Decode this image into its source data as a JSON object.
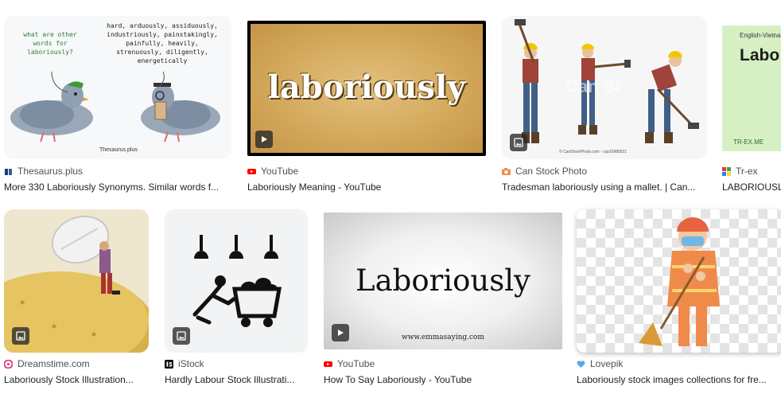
{
  "results": [
    {
      "source": "Thesaurus.plus",
      "title": "More 330 Laboriously Synonyms. Similar words f...",
      "image": {
        "left_bubble": "what are other words for laboriously?",
        "right_bubble": "hard, arduously, assiduously, industriously, painstakingly, painfully, heavily, strenuously, diligently, energetically",
        "footer": "Thesaurus.plus"
      },
      "badge": "none"
    },
    {
      "source": "YouTube",
      "title": "Laboriously Meaning - YouTube",
      "image": {
        "word": "laboriously"
      },
      "badge": "play-icon"
    },
    {
      "source": "Can Stock Photo",
      "title": "Tradesman laboriously using a mallet. | Can...",
      "image": {
        "watermark": "Can St",
        "footer": "© CanStockPhoto.com - csp10980521"
      },
      "badge": "image-icon"
    },
    {
      "source": "Tr-ex",
      "title": "LABORIOUSL",
      "image": {
        "top": "English-Vietna",
        "word": "Labo",
        "footer": "TR-EX.ME"
      },
      "badge": "none"
    },
    {
      "source": "Dreamstime.com",
      "title": "Laboriously Stock Illustration...",
      "image": {},
      "badge": "image-icon"
    },
    {
      "source": "iStock",
      "title": "Hardly Labour Stock Illustrati...",
      "image": {},
      "badge": "image-icon"
    },
    {
      "source": "YouTube",
      "title": "How To Say Laboriously - YouTube",
      "image": {
        "word": "Laboriously",
        "footer": "www.emmasaying.com"
      },
      "badge": "play-icon"
    },
    {
      "source": "Lovepik",
      "title": "Laboriously stock images collections for fre...",
      "image": {},
      "badge": "none"
    }
  ],
  "colors": {
    "youtube_red": "#ff0000",
    "card_bg": "#f1f3f4",
    "source_text": "#4d5156"
  }
}
